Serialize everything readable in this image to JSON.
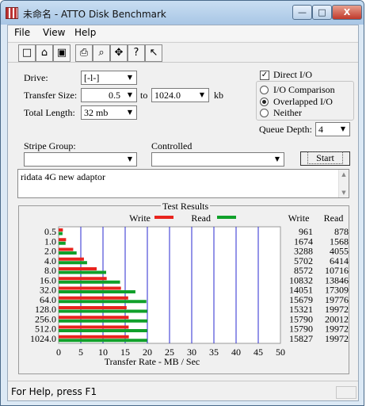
{
  "window": {
    "title": "未命名 - ATTO Disk Benchmark",
    "min": "—",
    "max": "□",
    "close": "X"
  },
  "menu": [
    "File",
    "View",
    "Help"
  ],
  "toolbar_icons": [
    "new-icon",
    "open-icon",
    "save-icon",
    "print-icon",
    "print-preview-icon",
    "move-icon",
    "about-icon",
    "context-help-icon"
  ],
  "form": {
    "drive_label": "Drive:",
    "drive_value": "[-l-]",
    "transfer_size_label": "Transfer Size:",
    "transfer_size_from": "0.5",
    "to_label": "to",
    "transfer_size_to": "1024.0",
    "kb_label": "kb",
    "total_length_label": "Total Length:",
    "total_length_value": "32 mb",
    "direct_io_label": "Direct I/O",
    "direct_io_checked": true,
    "io_comparison_label": "I/O Comparison",
    "overlapped_io_label": "Overlapped I/O",
    "neither_label": "Neither",
    "io_mode_selected": "Overlapped I/O",
    "queue_depth_label": "Queue Depth:",
    "queue_depth_value": "4",
    "stripe_group_label": "Stripe Group:",
    "controlled_label": "Controlled",
    "start_label": "Start",
    "description": "ridata 4G new adaptor"
  },
  "results": {
    "title": "Test Results",
    "legend_write": "Write",
    "legend_read": "Read",
    "col_write": "Write",
    "col_read": "Read",
    "write_color": "#e8241e",
    "read_color": "#10a02a"
  },
  "chart_data": {
    "type": "bar",
    "title": "Test Results",
    "xlabel": "Transfer Rate - MB / Sec",
    "xlim": [
      0,
      50
    ],
    "xticks": [
      0,
      5,
      10,
      15,
      20,
      25,
      30,
      35,
      40,
      45,
      50
    ],
    "categories": [
      "0.5",
      "1.0",
      "2.0",
      "4.0",
      "8.0",
      "16.0",
      "32.0",
      "64.0",
      "128.0",
      "256.0",
      "512.0",
      "1024.0"
    ],
    "series": [
      {
        "name": "Write",
        "values": [
          0.961,
          1.674,
          3.288,
          5.702,
          8.572,
          10.832,
          14.051,
          15.679,
          15.321,
          15.79,
          15.79,
          15.827
        ]
      },
      {
        "name": "Read",
        "values": [
          0.878,
          1.568,
          4.055,
          6.414,
          10.716,
          13.846,
          17.309,
          19.776,
          19.972,
          20.012,
          19.972,
          19.972
        ]
      }
    ],
    "write_text": [
      "961",
      "1674",
      "3288",
      "5702",
      "8572",
      "10832",
      "14051",
      "15679",
      "15321",
      "15790",
      "15790",
      "15827"
    ],
    "read_text": [
      "878",
      "1568",
      "4055",
      "6414",
      "10716",
      "13846",
      "17309",
      "19776",
      "19972",
      "20012",
      "19972",
      "19972"
    ]
  },
  "status": {
    "text": "For Help, press F1"
  }
}
